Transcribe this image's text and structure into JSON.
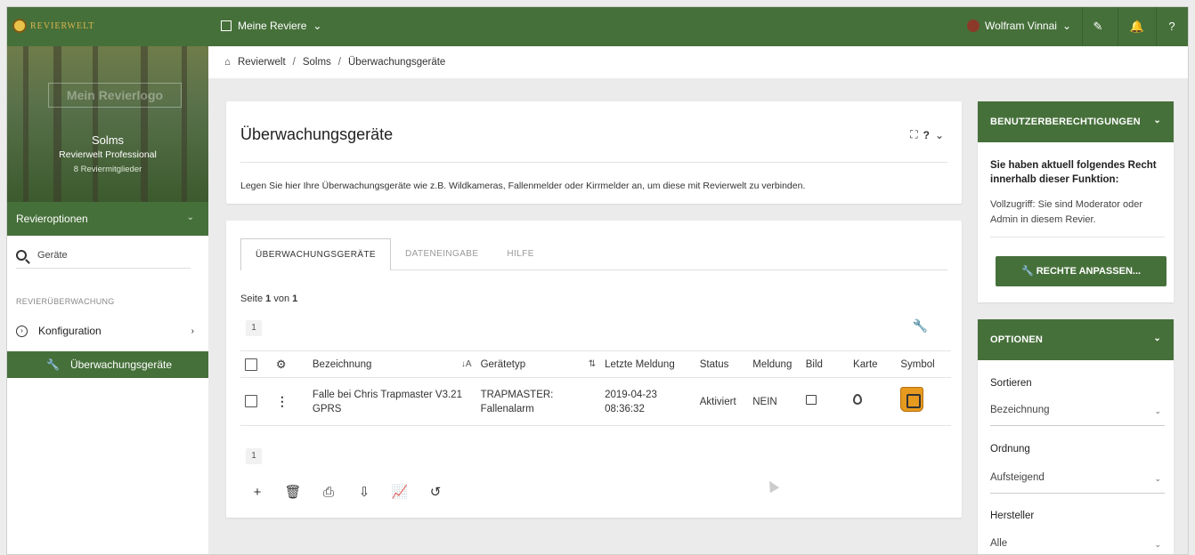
{
  "app": {
    "logo_text": "REVIERWELT"
  },
  "topbar": {
    "nav_reviere": "Meine Reviere",
    "user_name": "Wolfram Vinnai"
  },
  "sidebar": {
    "hero_logo": "Mein Revierlogo",
    "revier_name": "Solms",
    "revier_plan": "Revierwelt Professional",
    "revier_members": "8 Reviermitglieder",
    "options_label": "Revieroptionen",
    "search_label": "Geräte",
    "section_label": "REVIERÜBERWACHUNG",
    "konfig_label": "Konfiguration",
    "active_label": "Überwachungsgeräte"
  },
  "breadcrumb": {
    "items": [
      "Revierwelt",
      "Solms",
      "Überwachungsgeräte"
    ]
  },
  "main": {
    "title": "Überwachungsgeräte",
    "description": "Legen Sie hier Ihre Überwachungsgeräte wie z.B. Wildkameras, Fallenmelder oder Kirrmelder an, um diese mit Revierwelt zu verbinden.",
    "tabs": [
      "ÜBERWACHUNGSGERÄTE",
      "DATENEINGABE",
      "HILFE"
    ],
    "page_prefix": "Seite",
    "page_current": "1",
    "page_of": "von",
    "page_total": "1",
    "pager_top": "1",
    "pager_bottom": "1",
    "columns": [
      "Bezeichnung",
      "Gerätetyp",
      "Letzte Meldung",
      "Status",
      "Meldung",
      "Bild",
      "Karte",
      "Symbol"
    ],
    "rows": [
      {
        "bezeichnung_line1": "Falle bei Chris Trapmaster V3.21",
        "bezeichnung_line2": "GPRS",
        "typ_line1": "TRAPMASTER:",
        "typ_line2": "Fallenalarm",
        "meldung_date": "2019-04-23",
        "meldung_time": "08:36:32",
        "status": "Aktiviert",
        "meldung": "NEIN"
      }
    ]
  },
  "right": {
    "perm_header": "BENUTZERBERECHTIGUNGEN",
    "perm_bold": "Sie haben aktuell folgendes Recht innerhalb dieser Funktion:",
    "perm_text": "Vollzugriff: Sie sind Moderator oder Admin in diesem Revier.",
    "perm_button": "RECHTE ANPASSEN...",
    "opt_header": "OPTIONEN",
    "sort_label": "Sortieren",
    "sort_value": "Bezeichnung",
    "order_label": "Ordnung",
    "order_value": "Aufsteigend",
    "maker_label": "Hersteller",
    "maker_value": "Alle"
  },
  "colors": {
    "primary_green": "#46703a",
    "symbol_orange": "#e69a1e"
  }
}
